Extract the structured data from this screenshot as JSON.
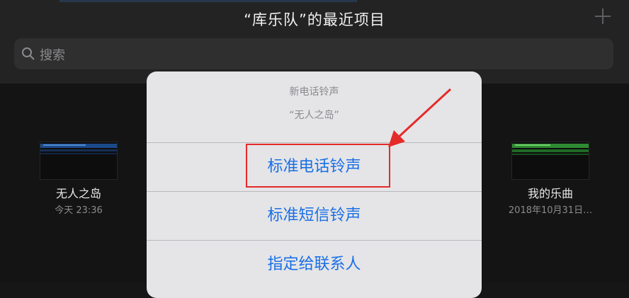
{
  "header": {
    "title": "“库乐队”的最近项目",
    "add_icon": "plus-icon"
  },
  "search": {
    "placeholder": "搜索",
    "icon": "magnifier-icon"
  },
  "projects": [
    {
      "name": "无人之岛",
      "date": "今天 23:36"
    },
    {
      "name": "我的乐曲",
      "date": "2018年10月31日…"
    }
  ],
  "action_sheet": {
    "title": "新电话铃声",
    "subtitle": "“无人之岛”",
    "options": [
      {
        "label": "标准电话铃声",
        "highlighted": true
      },
      {
        "label": "标准短信铃声"
      },
      {
        "label": "指定给联系人"
      }
    ]
  },
  "colors": {
    "accent": "#1a6fe6",
    "annotation": "#e52a2a",
    "sheet_background": "#e5e5e7"
  }
}
